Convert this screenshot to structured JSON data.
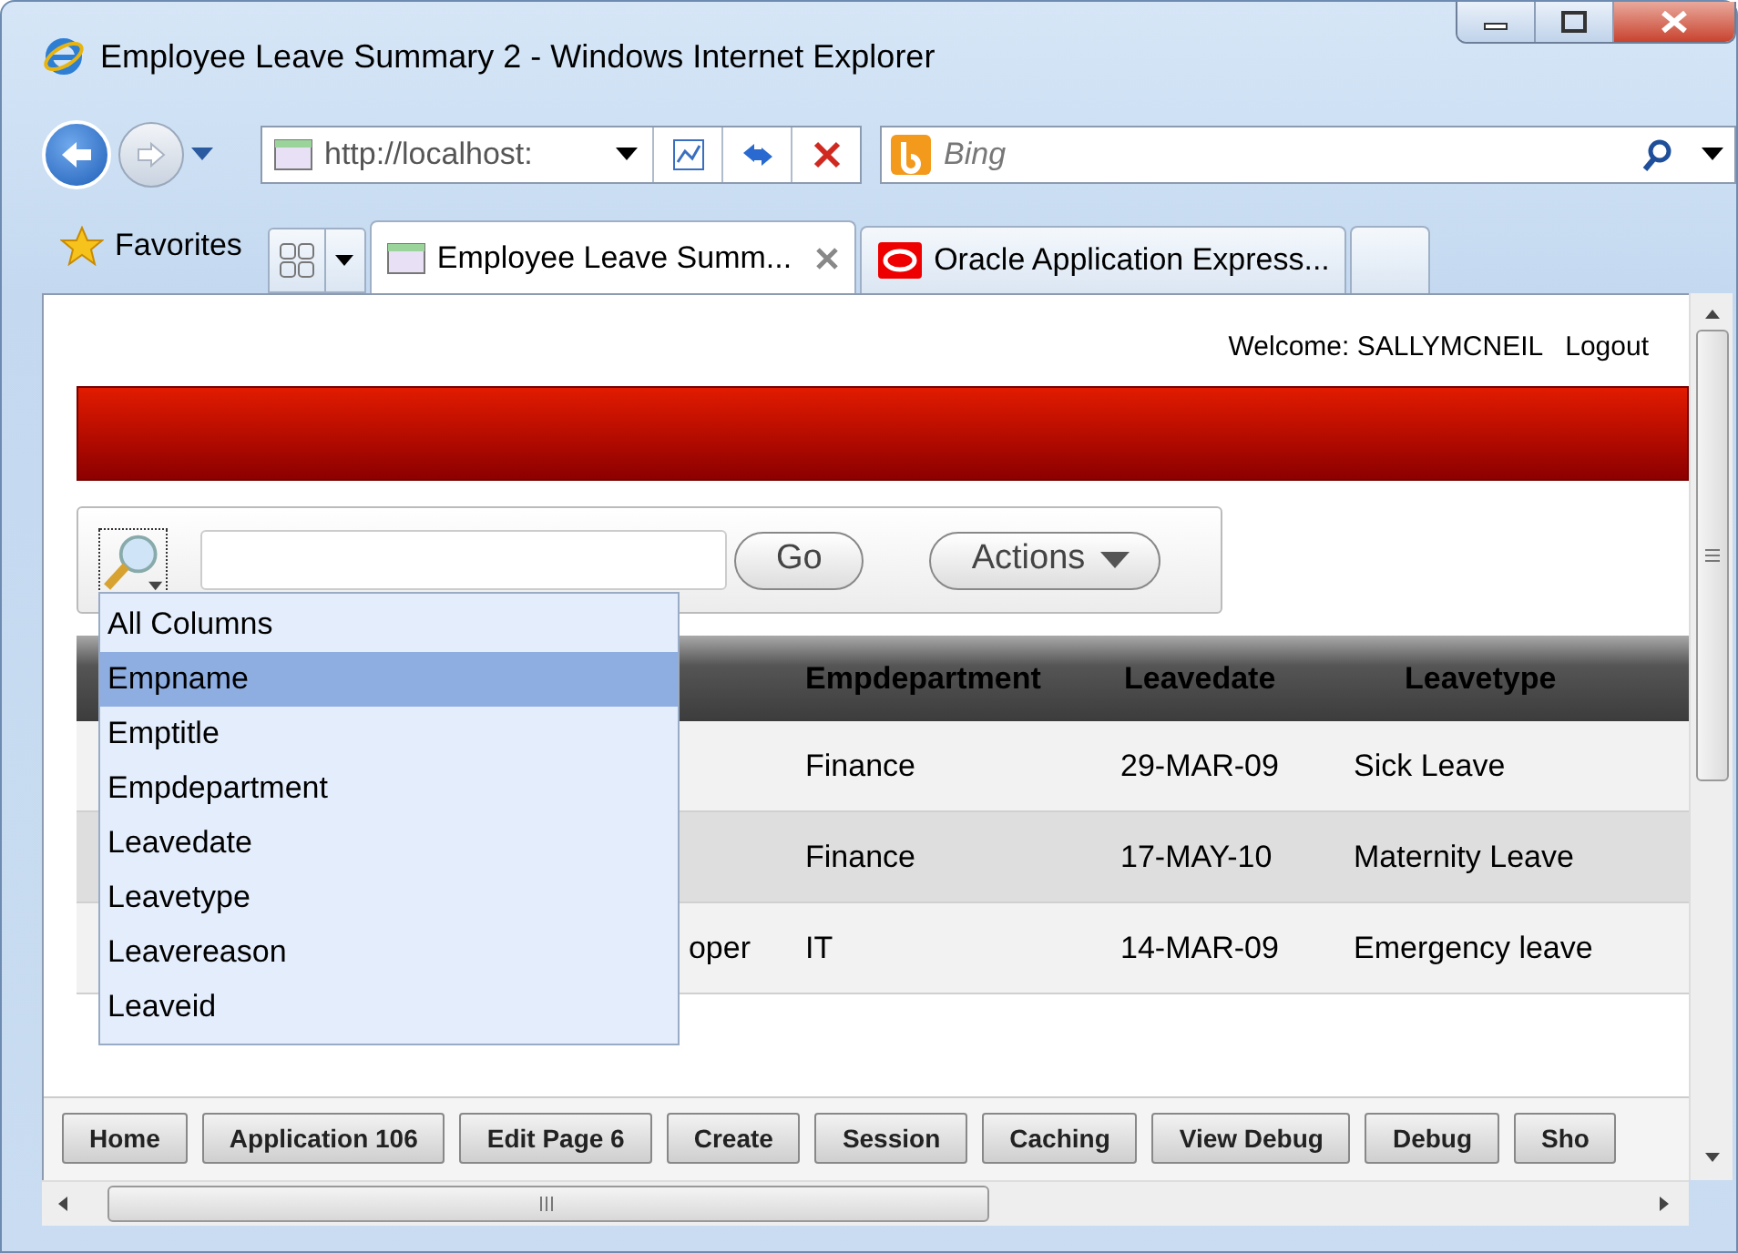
{
  "window": {
    "title": "Employee Leave Summary 2 - Windows Internet Explorer"
  },
  "navigation": {
    "address": "http://localhost:",
    "search_placeholder": "Bing"
  },
  "favorites": {
    "label": "Favorites"
  },
  "tabs": [
    {
      "label": "Employee Leave Summ...",
      "selected": true
    },
    {
      "label": "Oracle Application Express...",
      "selected": false
    }
  ],
  "page": {
    "welcome": "Welcome: SALLYMCNEIL",
    "logout": "Logout",
    "search": {
      "go": "Go",
      "actions": "Actions"
    },
    "column_menu": [
      {
        "label": "All Columns",
        "selected": false
      },
      {
        "label": "Empname",
        "selected": true
      },
      {
        "label": "Emptitle",
        "selected": false
      },
      {
        "label": "Empdepartment",
        "selected": false
      },
      {
        "label": "Leavedate",
        "selected": false
      },
      {
        "label": "Leavetype",
        "selected": false
      },
      {
        "label": "Leavereason",
        "selected": false
      },
      {
        "label": "Leaveid",
        "selected": false
      }
    ],
    "table": {
      "columns": [
        "Empdepartment",
        "Leavedate",
        "Leavetype"
      ],
      "rows": [
        {
          "empdepartment": "Finance",
          "leavedate": "29-MAR-09",
          "leavetype": "Sick Leave"
        },
        {
          "empdepartment": "Finance",
          "leavedate": "17-MAY-10",
          "leavetype": "Maternity Leave"
        },
        {
          "emptitle": "oper",
          "empdepartment": "IT",
          "leavedate": "14-MAR-09",
          "leavetype": "Emergency leave"
        }
      ]
    },
    "developer_toolbar": [
      "Home",
      "Application 106",
      "Edit Page 6",
      "Create",
      "Session",
      "Caching",
      "View Debug",
      "Debug",
      "Sho"
    ]
  }
}
